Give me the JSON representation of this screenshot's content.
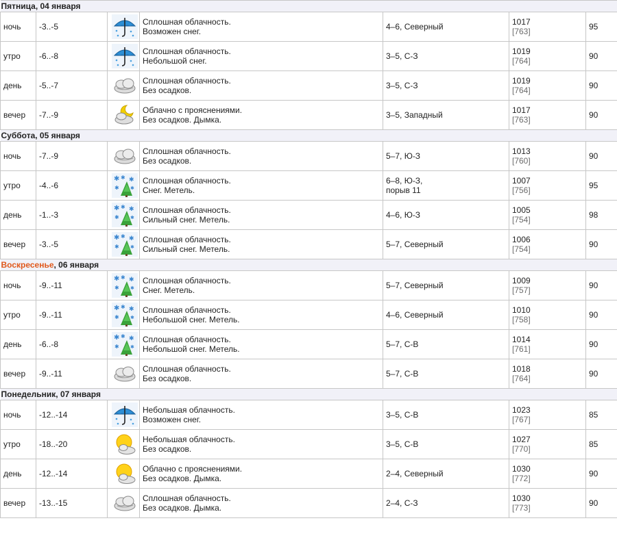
{
  "days": [
    {
      "title": "Пятница, 04 января",
      "is_sunday": false,
      "rows": [
        {
          "part": "ночь",
          "temp": "-3..-5",
          "icon": "umbrella-snow-icon",
          "desc": [
            "Сплошная облачность.",
            "Возможен снег."
          ],
          "wind": [
            "4–6, Северный"
          ],
          "press_hpa": "1017",
          "press_mm": "[763]",
          "hum": "95"
        },
        {
          "part": "утро",
          "temp": "-6..-8",
          "icon": "umbrella-snow-icon",
          "desc": [
            "Сплошная облачность.",
            "Небольшой снег."
          ],
          "wind": [
            "3–5, С-З"
          ],
          "press_hpa": "1019",
          "press_mm": "[764]",
          "hum": "90"
        },
        {
          "part": "день",
          "temp": "-5..-7",
          "icon": "cloud-icon",
          "desc": [
            "Сплошная облачность.",
            "Без осадков."
          ],
          "wind": [
            "3–5, С-З"
          ],
          "press_hpa": "1019",
          "press_mm": "[764]",
          "hum": "90"
        },
        {
          "part": "вечер",
          "temp": "-7..-9",
          "icon": "moon-cloud-icon",
          "desc": [
            "Облачно с прояснениями.",
            "Без осадков. Дымка."
          ],
          "wind": [
            "3–5, Западный"
          ],
          "press_hpa": "1017",
          "press_mm": "[763]",
          "hum": "90"
        }
      ]
    },
    {
      "title": "Суббота, 05 января",
      "is_sunday": false,
      "rows": [
        {
          "part": "ночь",
          "temp": "-7..-9",
          "icon": "cloud-icon",
          "desc": [
            "Сплошная облачность.",
            "Без осадков."
          ],
          "wind": [
            "5–7, Ю-З"
          ],
          "press_hpa": "1013",
          "press_mm": "[760]",
          "hum": "90"
        },
        {
          "part": "утро",
          "temp": "-4..-6",
          "icon": "blizzard-icon",
          "desc": [
            "Сплошная облачность.",
            "Снег. Метель."
          ],
          "wind": [
            "6–8, Ю-З,",
            "порыв 11"
          ],
          "press_hpa": "1007",
          "press_mm": "[756]",
          "hum": "95"
        },
        {
          "part": "день",
          "temp": "-1..-3",
          "icon": "blizzard-icon",
          "desc": [
            "Сплошная облачность.",
            "Сильный снег. Метель."
          ],
          "wind": [
            "4–6, Ю-З"
          ],
          "press_hpa": "1005",
          "press_mm": "[754]",
          "hum": "98"
        },
        {
          "part": "вечер",
          "temp": "-3..-5",
          "icon": "blizzard-icon",
          "desc": [
            "Сплошная облачность.",
            "Сильный снег. Метель."
          ],
          "wind": [
            "5–7, Северный"
          ],
          "press_hpa": "1006",
          "press_mm": "[754]",
          "hum": "90"
        }
      ]
    },
    {
      "title": "Воскресенье",
      "title_rest": ", 06 января",
      "is_sunday": true,
      "rows": [
        {
          "part": "ночь",
          "temp": "-9..-11",
          "icon": "blizzard-icon",
          "desc": [
            "Сплошная облачность.",
            "Снег. Метель."
          ],
          "wind": [
            "5–7, Северный"
          ],
          "press_hpa": "1009",
          "press_mm": "[757]",
          "hum": "90"
        },
        {
          "part": "утро",
          "temp": "-9..-11",
          "icon": "blizzard-icon",
          "desc": [
            "Сплошная облачность.",
            "Небольшой снег. Метель."
          ],
          "wind": [
            "4–6, Северный"
          ],
          "press_hpa": "1010",
          "press_mm": "[758]",
          "hum": "90"
        },
        {
          "part": "день",
          "temp": "-6..-8",
          "icon": "blizzard-icon",
          "desc": [
            "Сплошная облачность.",
            "Небольшой снег. Метель."
          ],
          "wind": [
            "5–7, С-В"
          ],
          "press_hpa": "1014",
          "press_mm": "[761]",
          "hum": "90"
        },
        {
          "part": "вечер",
          "temp": "-9..-11",
          "icon": "cloud-icon",
          "desc": [
            "Сплошная облачность.",
            "Без осадков."
          ],
          "wind": [
            "5–7, С-В"
          ],
          "press_hpa": "1018",
          "press_mm": "[764]",
          "hum": "90"
        }
      ]
    },
    {
      "title": "Понедельник, 07 января",
      "is_sunday": false,
      "rows": [
        {
          "part": "ночь",
          "temp": "-12..-14",
          "icon": "umbrella-snow-icon",
          "desc": [
            "Небольшая облачность.",
            "Возможен снег."
          ],
          "wind": [
            "3–5, С-В"
          ],
          "press_hpa": "1023",
          "press_mm": "[767]",
          "hum": "85"
        },
        {
          "part": "утро",
          "temp": "-18..-20",
          "icon": "sun-cloud-icon",
          "desc": [
            "Небольшая облачность.",
            "Без осадков."
          ],
          "wind": [
            "3–5, С-В"
          ],
          "press_hpa": "1027",
          "press_mm": "[770]",
          "hum": "85"
        },
        {
          "part": "день",
          "temp": "-12..-14",
          "icon": "sun-cloud-icon",
          "desc": [
            "Облачно с прояснениями.",
            "Без осадков. Дымка."
          ],
          "wind": [
            "2–4, Северный"
          ],
          "press_hpa": "1030",
          "press_mm": "[772]",
          "hum": "90"
        },
        {
          "part": "вечер",
          "temp": "-13..-15",
          "icon": "cloud-icon",
          "desc": [
            "Сплошная облачность.",
            "Без осадков. Дымка."
          ],
          "wind": [
            "2–4, С-З"
          ],
          "press_hpa": "1030",
          "press_mm": "[773]",
          "hum": "90"
        }
      ]
    }
  ],
  "colors": {
    "sunday": "#e0581c",
    "header_bg": "#f1f1f8",
    "border": "#c6c6c6",
    "mm_text": "#6b6b6b"
  }
}
